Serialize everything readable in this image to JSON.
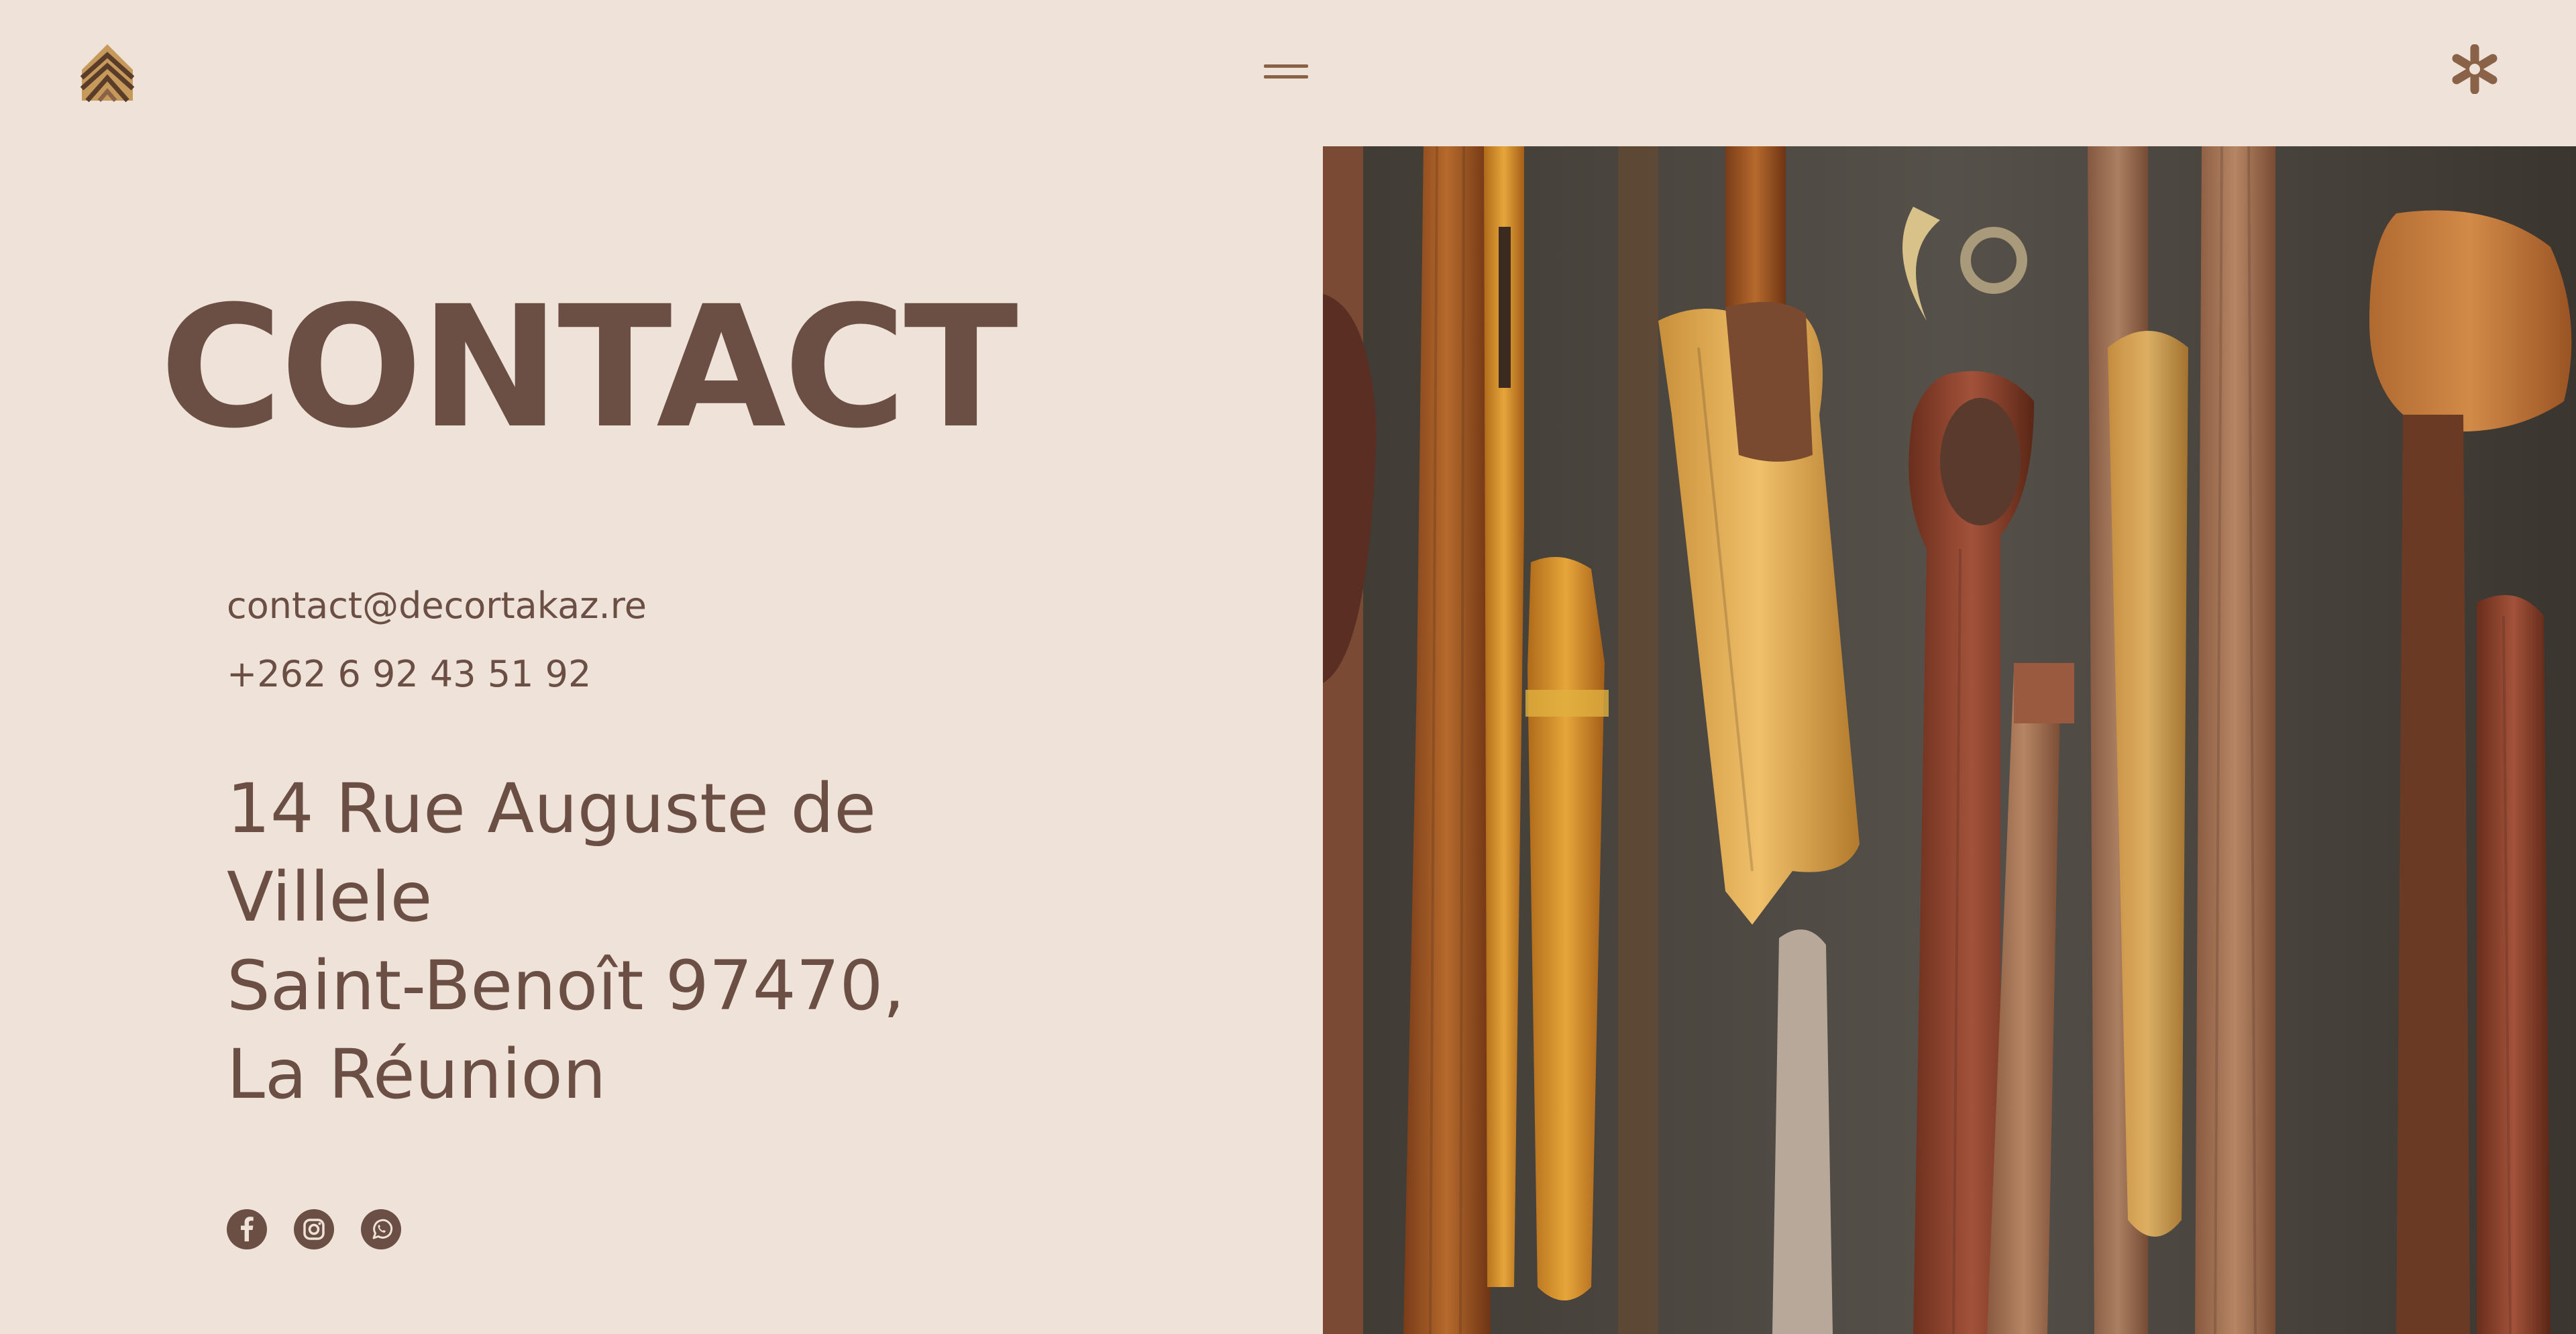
{
  "colors": {
    "background": "#efe2d8",
    "text": "#6b4f45",
    "accent": "#8a6248",
    "logo_light": "#c69a5a",
    "logo_dark": "#5a3c2a"
  },
  "header": {
    "logo_icon": "house-logo-icon",
    "menu_icon": "hamburger-menu-icon",
    "asterisk_icon": "asterisk-icon"
  },
  "contact": {
    "title": "CONTACT",
    "email": "contact@decortakaz.re",
    "phone": "+262 6 92 43 51 92",
    "address_lines": [
      "14 Rue Auguste de",
      "Villele",
      "Saint-Benoît 97470,",
      "La Réunion"
    ]
  },
  "socials": [
    {
      "icon": "facebook-icon"
    },
    {
      "icon": "instagram-icon"
    },
    {
      "icon": "whatsapp-icon"
    }
  ],
  "hero_image": {
    "subject": "carved-wooden-tools-artwork"
  }
}
